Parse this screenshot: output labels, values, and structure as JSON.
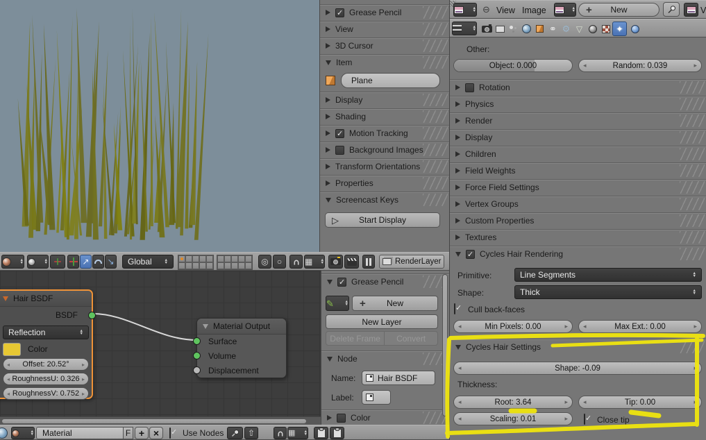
{
  "colors": {
    "viewport_bg": "#7d8e9a",
    "grass_base": "#7f7f20",
    "node_select_outline": "#ef9338",
    "annotation": "#f2e70c",
    "active_tab_bg": "#4f79bd",
    "socket_green": "#5fc45f",
    "hair_color_swatch": "#e7c833"
  },
  "icons": {
    "play": "▷",
    "pencil": "✎",
    "plus": "+",
    "close": "×",
    "circle_minus": "⊖",
    "constraint_rings": "⚭",
    "modifier_tool": "⚙",
    "data_triangle": "▽",
    "snap_grid": "▦",
    "prop_edit": "◎",
    "prop_falloff": "○",
    "up_arrow": "⇧",
    "move_arrow": "↗",
    "scale_arrow": "↘",
    "sparkle": "✦",
    "fkey": "F"
  },
  "view3d": {
    "panels": [
      "Grease Pencil",
      "View",
      "3D Cursor",
      "Item",
      "Display",
      "Shading",
      "Motion Tracking",
      "Background Images",
      "Transform Orientations",
      "Properties",
      "Screencast Keys"
    ],
    "object_name": "Plane",
    "start_display": "Start Display",
    "header": {
      "orientation": "Global",
      "render_layer": "RenderLayer"
    }
  },
  "node_editor": {
    "hair_bsdf": {
      "title": "Hair BSDF",
      "output": "BSDF",
      "component": "Reflection",
      "color_label": "Color",
      "offset": "Offset: 20.52°",
      "roughness_u": "RoughnessU: 0.326",
      "roughness_v": "RoughnessV: 0.752"
    },
    "material_output": {
      "title": "Material Output",
      "inputs": [
        "Surface",
        "Volume",
        "Displacement"
      ]
    },
    "sidebar": {
      "grease_pencil": "Grease Pencil",
      "new_button": "New",
      "new_layer": "New Layer",
      "delete_frame": "Delete Frame",
      "convert": "Convert",
      "node_panel": "Node",
      "name_label": "Name:",
      "name_value": "Hair BSDF",
      "label_label": "Label:",
      "color_panel": "Color"
    },
    "header": {
      "material_name": "Material",
      "fake_user": "F",
      "use_nodes": "Use Nodes"
    }
  },
  "image_editor": {
    "menu_view": "View",
    "menu_image": "Image",
    "new_button": "New",
    "clipped_label": "Vie"
  },
  "properties": {
    "other_label": "Other:",
    "object_field": "Object: 0.000",
    "random_field": "Random: 0.039",
    "collapsed_panels": [
      "Rotation",
      "Physics",
      "Render",
      "Display",
      "Children",
      "Field Weights",
      "Force Field Settings",
      "Vertex Groups",
      "Custom Properties",
      "Textures"
    ],
    "hair_rendering": {
      "title": "Cycles Hair Rendering",
      "primitive_label": "Primitive:",
      "primitive_value": "Line Segments",
      "shape_label": "Shape:",
      "shape_value": "Thick",
      "cull": "Cull back-faces",
      "min_pixels": "Min Pixels: 0.00",
      "max_ext": "Max Ext.: 0.00"
    },
    "hair_settings": {
      "title": "Cycles Hair Settings",
      "shape": "Shape: -0.09",
      "thickness_label": "Thickness:",
      "root": "Root: 3.64",
      "tip": "Tip: 0.00",
      "scaling": "Scaling: 0.01",
      "close_tip": "Close tip"
    }
  }
}
